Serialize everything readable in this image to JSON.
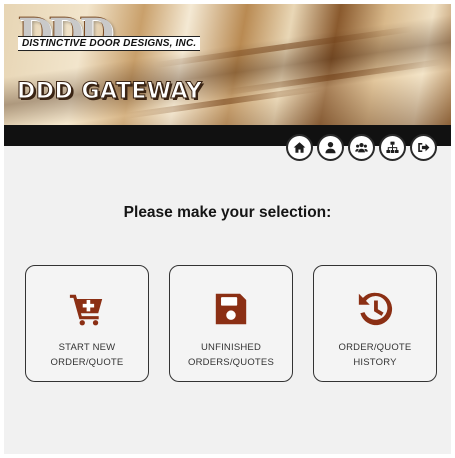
{
  "header": {
    "logo_letters": "DDD",
    "company_name": "DISTINCTIVE DOOR DESIGNS, INC.",
    "app_title": "DDD GATEWAY"
  },
  "nav": [
    {
      "icon": "home-icon"
    },
    {
      "icon": "user-icon"
    },
    {
      "icon": "users-icon"
    },
    {
      "icon": "sitemap-icon"
    },
    {
      "icon": "sign-out-icon"
    }
  ],
  "main": {
    "prompt": "Please make your selection:",
    "cards": [
      {
        "icon": "cart-plus-icon",
        "line1": "START NEW",
        "line2": "ORDER/QUOTE"
      },
      {
        "icon": "save-icon",
        "line1": "UNFINISHED",
        "line2": "ORDERS/QUOTES"
      },
      {
        "icon": "history-icon",
        "line1": "ORDER/QUOTE",
        "line2": "HISTORY"
      }
    ]
  },
  "colors": {
    "accent": "#8b2f14",
    "band": "#111111",
    "background": "#f1f1f1"
  }
}
